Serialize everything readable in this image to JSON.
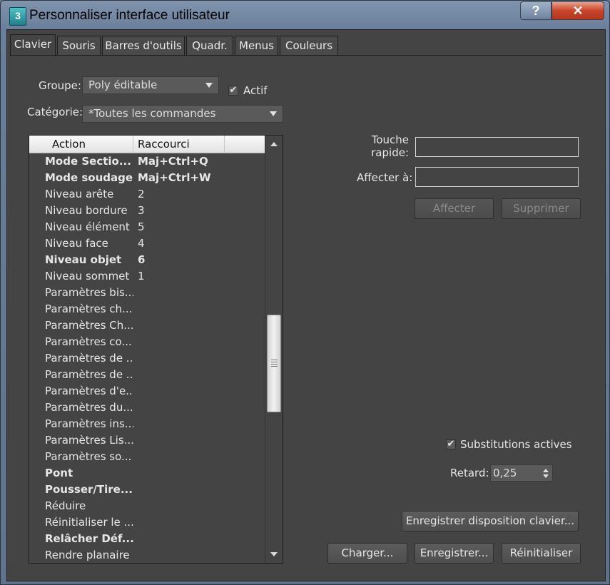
{
  "window": {
    "title": "Personnaliser interface utilisateur",
    "icon_text": "3",
    "help_label": "?",
    "close_label": "✕"
  },
  "tabs": [
    "Clavier",
    "Souris",
    "Barres d'outils",
    "Quadr.",
    "Menus",
    "Couleurs"
  ],
  "active_tab": "Clavier",
  "group": {
    "label": "Groupe:",
    "value": "Poly éditable"
  },
  "active_checkbox": {
    "label": "Actif",
    "checked": true
  },
  "category": {
    "label": "Catégorie:",
    "value": "*Toutes les commandes"
  },
  "list": {
    "col_action": "Action",
    "col_shortcut": "Raccourci",
    "rows": [
      {
        "action": "Mode Sectio...",
        "shortcut": "Maj+Ctrl+Q",
        "bold": true
      },
      {
        "action": "Mode soudage",
        "shortcut": "Maj+Ctrl+W",
        "bold": true
      },
      {
        "action": "Niveau arête",
        "shortcut": "2",
        "bold": false
      },
      {
        "action": "Niveau bordure",
        "shortcut": "3",
        "bold": false
      },
      {
        "action": "Niveau élément",
        "shortcut": "5",
        "bold": false
      },
      {
        "action": "Niveau face",
        "shortcut": "4",
        "bold": false
      },
      {
        "action": "Niveau objet",
        "shortcut": "6",
        "bold": true
      },
      {
        "action": "Niveau sommet",
        "shortcut": "1",
        "bold": false
      },
      {
        "action": "Paramètres bis...",
        "shortcut": "",
        "bold": false
      },
      {
        "action": "Paramètres ch...",
        "shortcut": "",
        "bold": false
      },
      {
        "action": "Paramètres Ch...",
        "shortcut": "",
        "bold": false
      },
      {
        "action": "Paramètres co...",
        "shortcut": "",
        "bold": false
      },
      {
        "action": "Paramètres de ...",
        "shortcut": "",
        "bold": false
      },
      {
        "action": "Paramètres de ...",
        "shortcut": "",
        "bold": false
      },
      {
        "action": "Paramètres d'e...",
        "shortcut": "",
        "bold": false
      },
      {
        "action": "Paramètres du...",
        "shortcut": "",
        "bold": false
      },
      {
        "action": "Paramètres ins...",
        "shortcut": "",
        "bold": false
      },
      {
        "action": "Paramètres Lis...",
        "shortcut": "",
        "bold": false
      },
      {
        "action": "Paramètres so...",
        "shortcut": "",
        "bold": false
      },
      {
        "action": "Pont",
        "shortcut": "",
        "bold": true
      },
      {
        "action": "Pousser/Tire...",
        "shortcut": "",
        "bold": true
      },
      {
        "action": "Réduire",
        "shortcut": "",
        "bold": false
      },
      {
        "action": "Réinitialiser le ...",
        "shortcut": "",
        "bold": false
      },
      {
        "action": "Relâcher Déf...",
        "shortcut": "",
        "bold": true
      },
      {
        "action": "Rendre planaire",
        "shortcut": "",
        "bold": false
      }
    ]
  },
  "hotkey": {
    "label_line1": "Touche",
    "label_line2": "rapide:",
    "value": ""
  },
  "assign_to": {
    "label": "Affecter à:",
    "value": ""
  },
  "buttons": {
    "assign": "Affecter",
    "remove": "Supprimer",
    "save_layout": "Enregistrer disposition clavier...",
    "load": "Charger...",
    "save": "Enregistrer...",
    "reset": "Réinitialiser"
  },
  "overrides": {
    "label": "Substitutions actives",
    "checked": true
  },
  "delay": {
    "label": "Retard:",
    "value": "0,25"
  }
}
